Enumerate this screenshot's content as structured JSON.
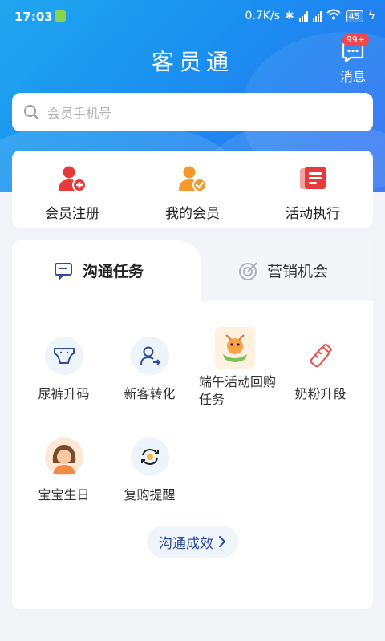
{
  "status_bar": {
    "time": "17:03",
    "speed": "0.7K/s",
    "battery": "45"
  },
  "header": {
    "title": "客员通",
    "message_label": "消息",
    "message_badge": "99+"
  },
  "search": {
    "placeholder": "会员手机号"
  },
  "quick_actions": [
    {
      "label": "会员注册",
      "icon": "user-plus-icon",
      "color": "#e83a3a"
    },
    {
      "label": "我的会员",
      "icon": "user-check-icon",
      "color": "#f39a2b"
    },
    {
      "label": "活动执行",
      "icon": "task-list-icon",
      "color": "#e83a3a"
    }
  ],
  "tabs": [
    {
      "label": "沟通任务",
      "icon": "chat-icon",
      "active": true
    },
    {
      "label": "营销机会",
      "icon": "target-icon",
      "active": false
    }
  ],
  "tasks": [
    {
      "label": "尿裤升码",
      "icon": "diaper-icon"
    },
    {
      "label": "新客转化",
      "icon": "user-convert-icon"
    },
    {
      "label": "端午活动回购任务",
      "icon": "dragon-boat-icon"
    },
    {
      "label": "奶粉升段",
      "icon": "baby-bottle-icon"
    },
    {
      "label": "宝宝生日",
      "icon": "baby-avatar-icon"
    },
    {
      "label": "复购提醒",
      "icon": "repurchase-icon"
    }
  ],
  "link_button": {
    "label": "沟通成效"
  },
  "colors": {
    "brand_blue": "#1a8ff0",
    "accent_red": "#e83a3a",
    "accent_orange": "#f39a2b"
  }
}
